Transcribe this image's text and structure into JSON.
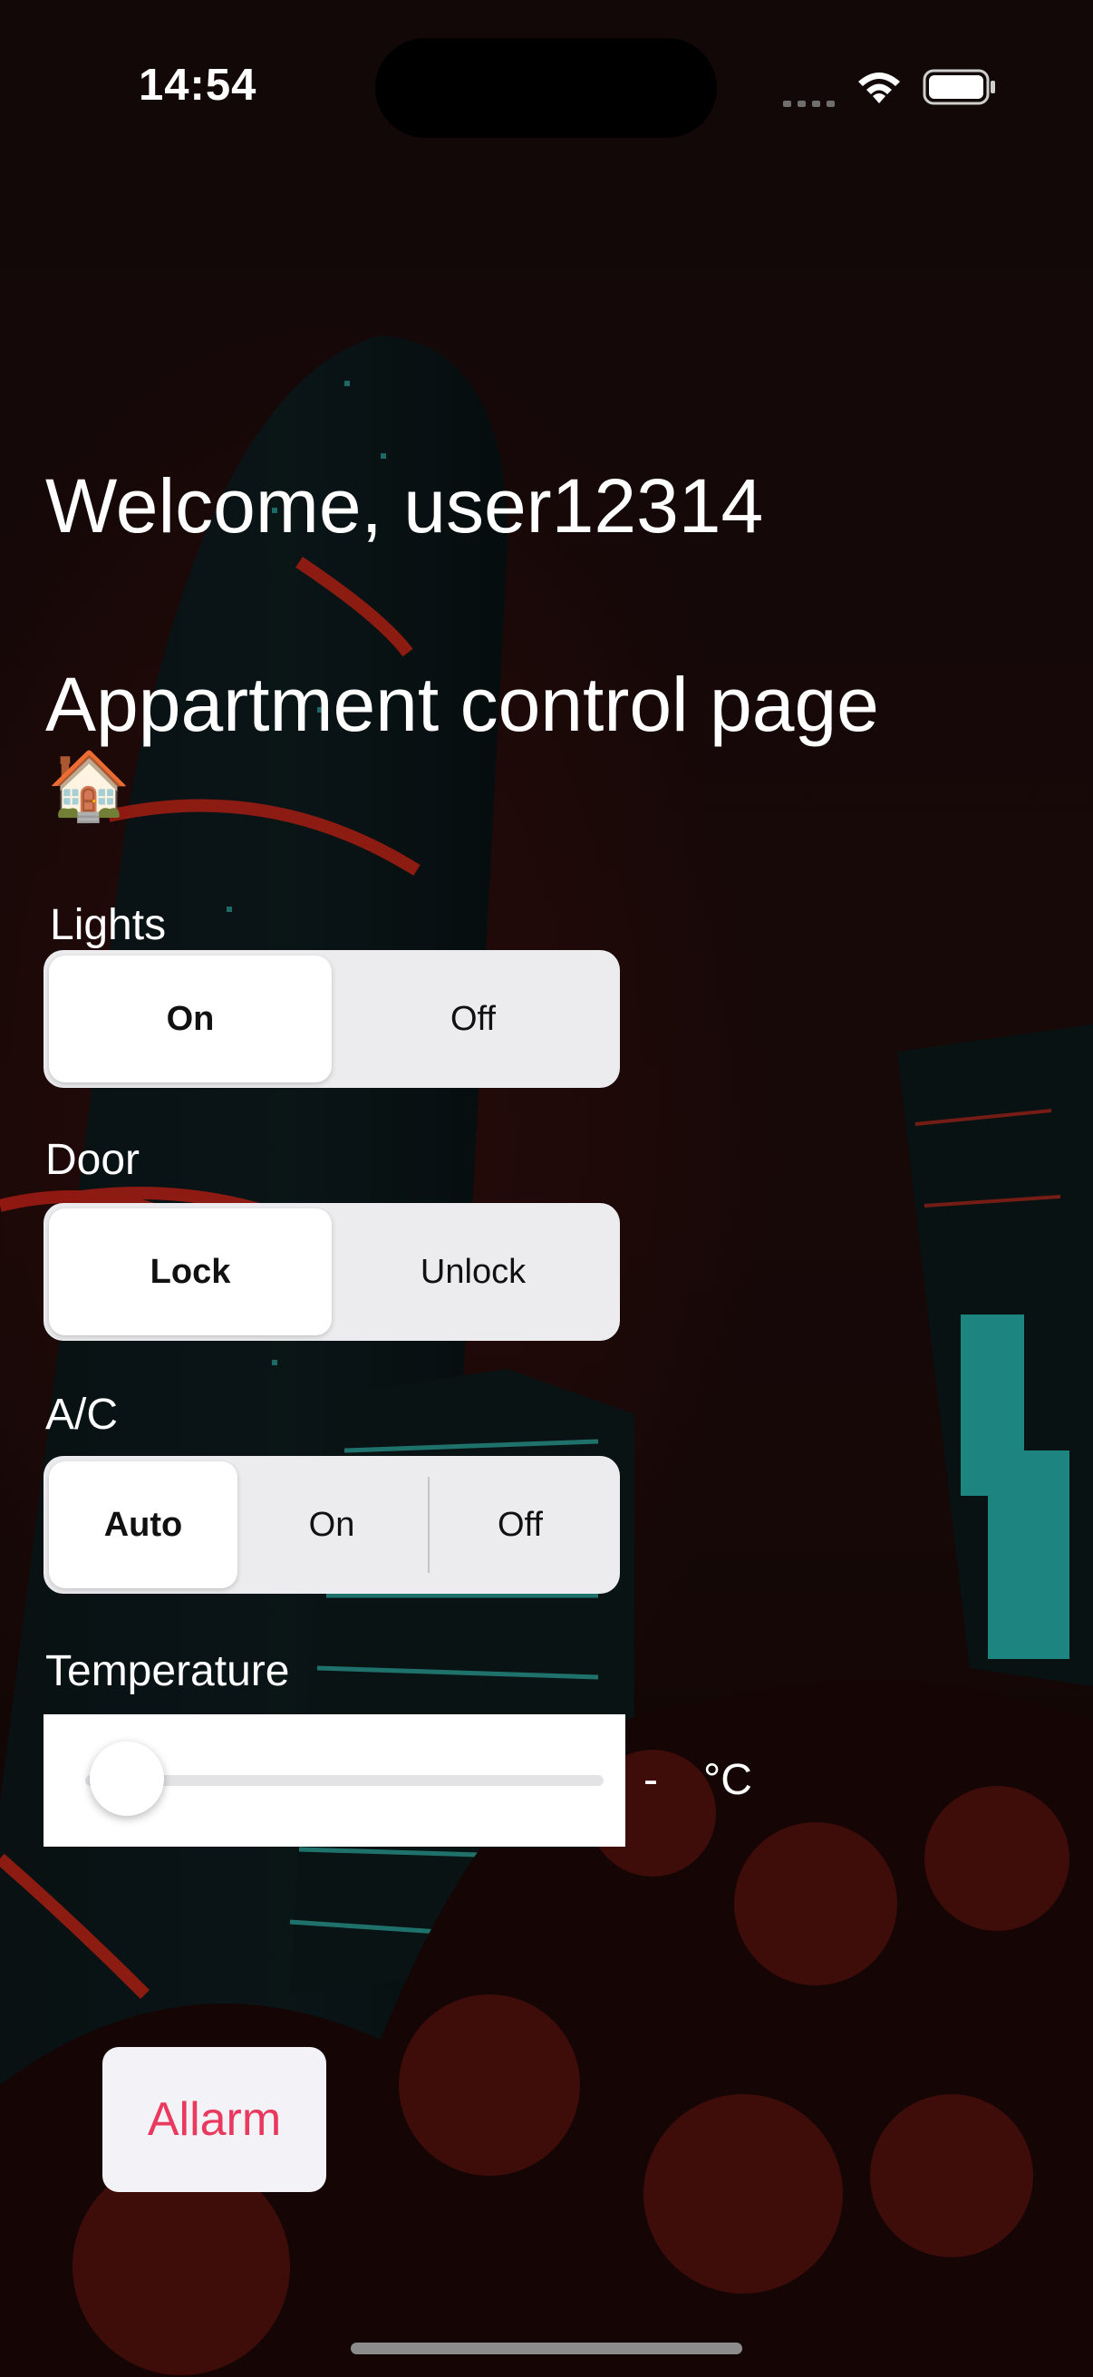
{
  "status_bar": {
    "time": "14:54"
  },
  "header": {
    "welcome": "Welcome, user12314",
    "subtitle": "Appartment control page",
    "emoji": "🏠"
  },
  "lights": {
    "label": "Lights",
    "options": [
      "On",
      "Off"
    ],
    "selected": "On"
  },
  "door": {
    "label": "Door",
    "options": [
      "Lock",
      "Unlock"
    ],
    "selected": "Lock"
  },
  "ac": {
    "label": "A/C",
    "options": [
      "Auto",
      "On",
      "Off"
    ],
    "selected": "Auto"
  },
  "temperature": {
    "label": "Temperature",
    "value": "-",
    "unit": "°C",
    "slider_fraction": 0
  },
  "alarm_button": {
    "label": "Allarm"
  },
  "colors": {
    "alarm_text": "#e9395f",
    "segment_bg": "#ececee"
  }
}
